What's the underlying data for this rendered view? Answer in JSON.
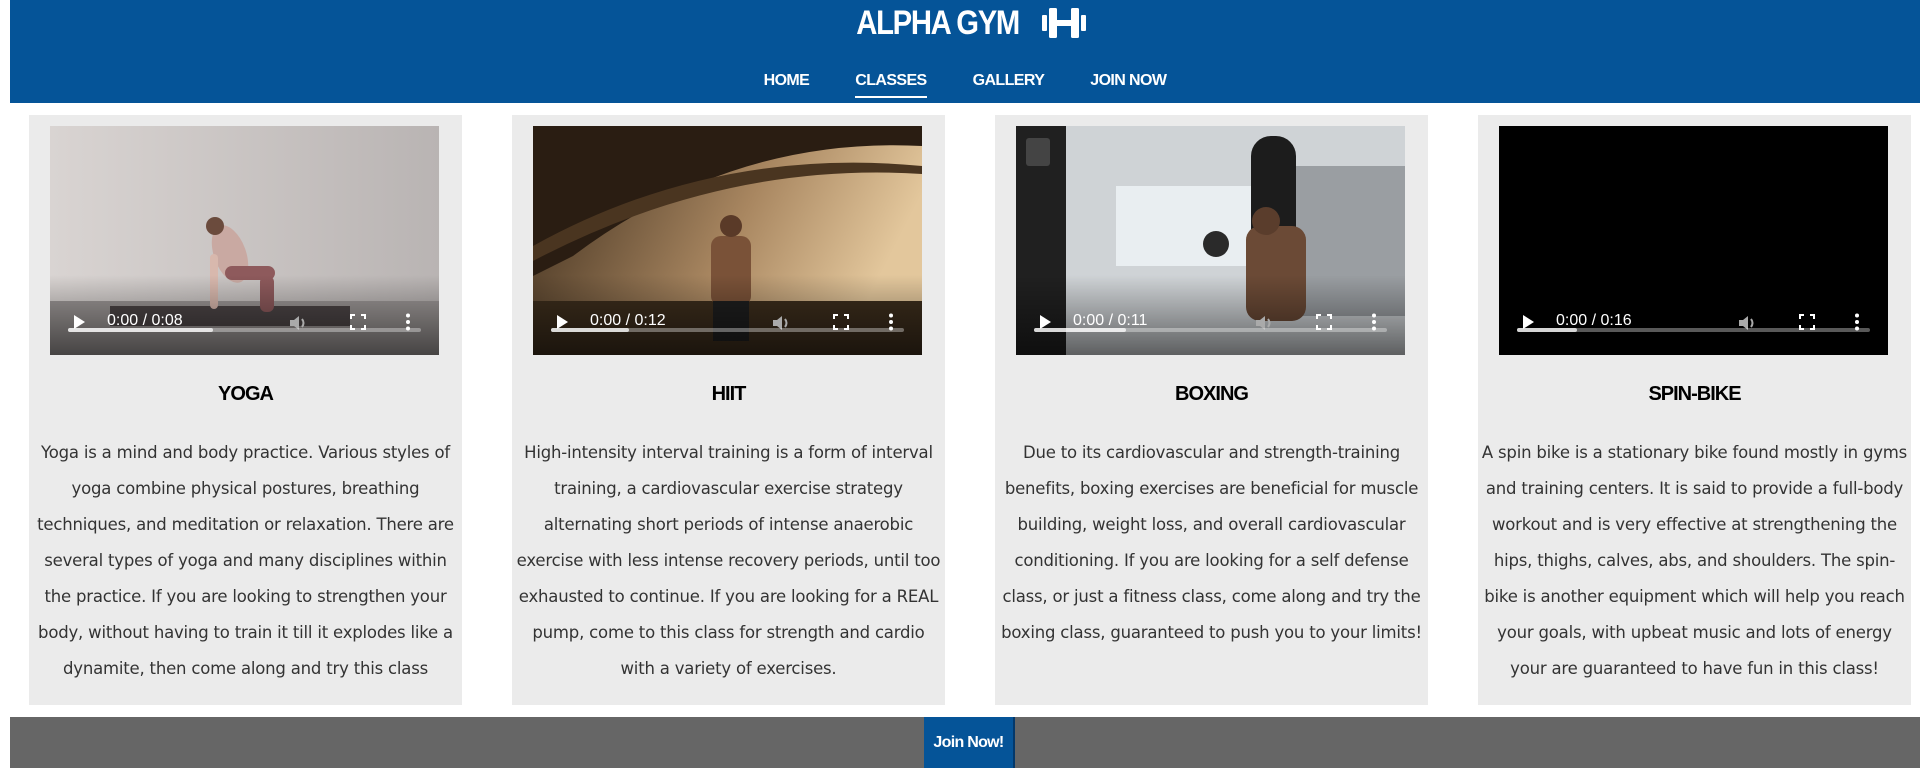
{
  "colors": {
    "header_bg": "#055498",
    "card_bg": "#ebebeb",
    "footer_bg": "#666666",
    "join_button_bg": "#055498"
  },
  "header": {
    "brand": "ALPHA GYM",
    "brand_icon": "dumbbell-icon",
    "nav": [
      {
        "label": "HOME",
        "active": false
      },
      {
        "label": "CLASSES",
        "active": true
      },
      {
        "label": "GALLERY",
        "active": false
      },
      {
        "label": "JOIN NOW",
        "active": false
      }
    ]
  },
  "classes": [
    {
      "title": "YOGA",
      "time": "0:00 / 0:08",
      "buffered": 0.41,
      "description": "Yoga is a mind and body practice. Various styles of yoga combine physical postures, breathing techniques, and meditation or relaxation. There are several types of yoga and many disciplines within the practice. If you are looking to strengthen your body, without having to train it till it explodes like a dynamite, then come along and try this class"
    },
    {
      "title": "HIIT",
      "time": "0:00 / 0:12",
      "buffered": 0.22,
      "description": "High-intensity interval training is a form of interval training, a cardiovascular exercise strategy alternating short periods of intense anaerobic exercise with less intense recovery periods, until too exhausted to continue. If you are looking for a REAL pump, come to this class for strength and cardio with a variety of exercises."
    },
    {
      "title": "BOXING",
      "time": "0:00 / 0:11",
      "buffered": 0.26,
      "description": "Due to its cardiovascular and strength-training benefits, boxing exercises are beneficial for muscle building, weight loss, and overall cardiovascular conditioning. If you are looking for a self defense class, or just a fitness class, come along and try the boxing class, guaranteed to push you to your limits!"
    },
    {
      "title": "SPIN-BIKE",
      "time": "0:00 / 0:16",
      "buffered": 0.17,
      "description": "A spin bike is a stationary bike found mostly in gyms and training centers. It is said to provide a full-body workout and is very effective at strengthening the hips, thighs, calves, abs, and shoulders. The spin-bike is another equipment which will help you reach your goals, with upbeat music and lots of energy your are guaranteed to have fun in this class!"
    }
  ],
  "footer": {
    "join_label": "Join Now!"
  }
}
